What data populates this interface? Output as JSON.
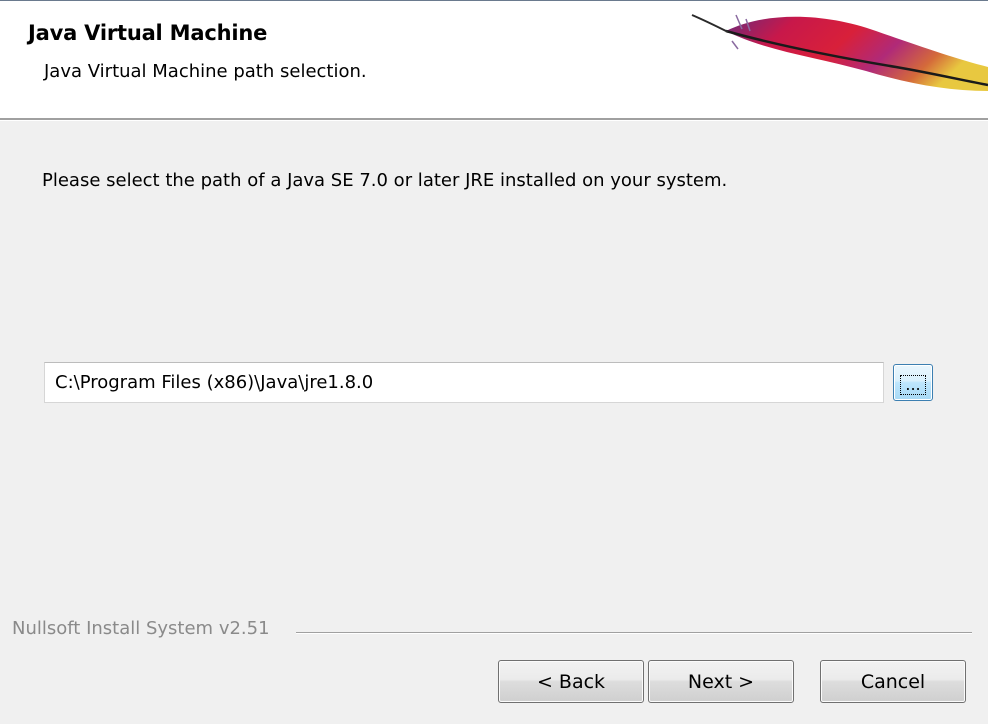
{
  "header": {
    "title": "Java Virtual Machine",
    "subtitle": "Java Virtual Machine path selection."
  },
  "main": {
    "instruction": "Please select the path of a Java SE 7.0 or later JRE installed on your system.",
    "path_value": "C:\\Program Files (x86)\\Java\\jre1.8.0",
    "browse_label": "..."
  },
  "footer": {
    "branding": "Nullsoft Install System v2.51",
    "back_label": "< Back",
    "next_label": "Next >",
    "cancel_label": "Cancel"
  },
  "icons": {
    "header_logo": "apache-feather-icon",
    "browse": "ellipsis-icon"
  },
  "colors": {
    "dialog_background": "#f0f0f0",
    "header_background": "#ffffff",
    "browse_focus_border": "#3c7fb1",
    "branding_text": "#8a8a8a"
  }
}
